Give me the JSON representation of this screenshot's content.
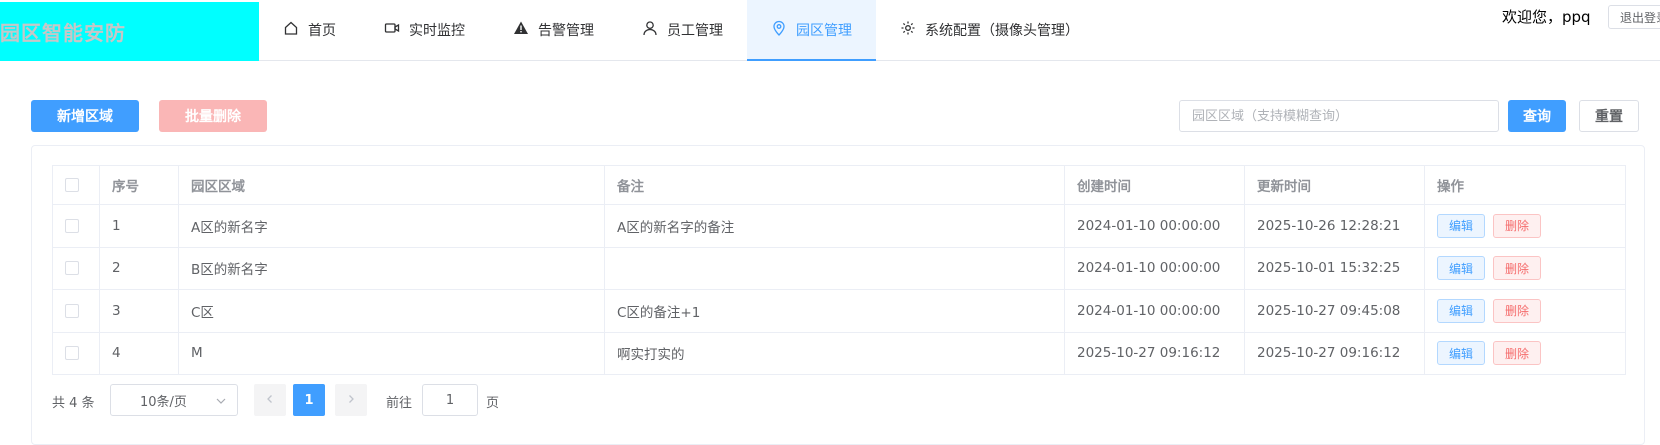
{
  "header": {
    "logo": "园区智能安防",
    "nav": [
      {
        "label": "首页",
        "icon": "home-icon"
      },
      {
        "label": "实时监控",
        "icon": "video-camera-icon"
      },
      {
        "label": "告警管理",
        "icon": "warning-icon"
      },
      {
        "label": "员工管理",
        "icon": "user-icon"
      },
      {
        "label": "园区管理",
        "icon": "location-icon",
        "active": true
      },
      {
        "label": "系统配置（摄像头管理）",
        "icon": "gear-icon"
      }
    ],
    "welcome": "欢迎您，ppq",
    "logout": "退出登录"
  },
  "toolbar": {
    "add_label": "新增区域",
    "batch_delete_label": "批量删除",
    "search_placeholder": "园区区域（支持模糊查询）",
    "search_value": "",
    "query_label": "查询",
    "reset_label": "重置"
  },
  "table": {
    "columns": [
      "序号",
      "园区区域",
      "备注",
      "创建时间",
      "更新时间",
      "操作"
    ],
    "rows": [
      {
        "id": "1",
        "area": "A区的新名字",
        "remark": "A区的新名字的备注",
        "created": "2024-01-10 00:00:00",
        "updated": "2025-10-26 12:28:21"
      },
      {
        "id": "2",
        "area": "B区的新名字",
        "remark": "",
        "created": "2024-01-10 00:00:00",
        "updated": "2025-10-01 15:32:25"
      },
      {
        "id": "3",
        "area": "C区",
        "remark": "C区的备注+1",
        "created": "2024-01-10 00:00:00",
        "updated": "2025-10-27 09:45:08"
      },
      {
        "id": "4",
        "area": "M",
        "remark": "啊实打实的",
        "created": "2025-10-27 09:16:12",
        "updated": "2025-10-27 09:16:12"
      }
    ],
    "edit_label": "编辑",
    "delete_label": "删除"
  },
  "pagination": {
    "total": "共 4 条",
    "page_size": "10条/页",
    "current_page": "1",
    "goto_prefix": "前往",
    "goto_value": "1",
    "goto_suffix": "页"
  },
  "colors": {
    "primary": "#409eff",
    "danger": "#f56c6c",
    "logo_bg": "#00ffff"
  }
}
